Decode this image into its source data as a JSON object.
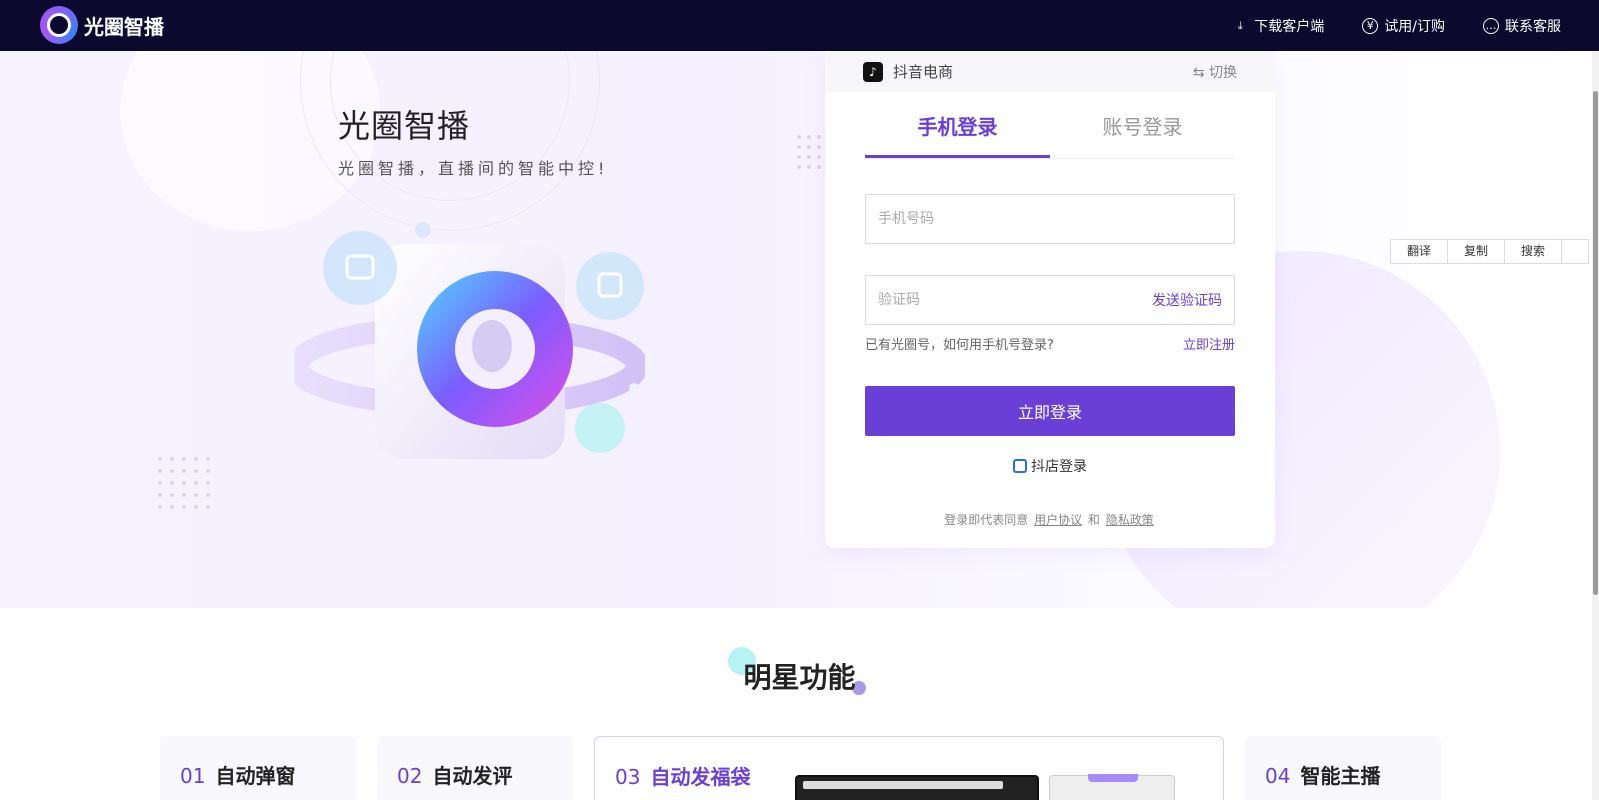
{
  "nav": {
    "logo_text": "光圈智播",
    "links": [
      {
        "label": "下载客户端",
        "icon": "download-icon",
        "glyph": "⤓"
      },
      {
        "label": "试用/订购",
        "icon": "yen-icon",
        "glyph": "¥"
      },
      {
        "label": "联系客服",
        "icon": "chat-icon",
        "glyph": "…"
      }
    ]
  },
  "hero": {
    "title": "光圈智播",
    "subtitle": "光圈智播，直播间的智能中控!"
  },
  "login": {
    "platform": "抖音电商",
    "switch_label": "⇆ 切换",
    "tabs": [
      "手机登录",
      "账号登录"
    ],
    "phone_placeholder": "手机号码",
    "code_placeholder": "验证码",
    "send_code": "发送验证码",
    "hint": "已有光圈号，如何用手机号登录?",
    "register": "立即注册",
    "submit": "立即登录",
    "shop_login": "抖店登录",
    "agree_prefix": "登录即代表同意",
    "agree_terms": "用户协议",
    "agree_and": "和",
    "agree_privacy": "隐私政策"
  },
  "sidetool": [
    "翻译",
    "复制",
    "搜索",
    ""
  ],
  "features": {
    "title": "明星功能",
    "items": [
      {
        "num": "01",
        "label": "自动弹窗"
      },
      {
        "num": "02",
        "label": "自动发评"
      },
      {
        "num": "03",
        "label": "自动发福袋"
      },
      {
        "num": "04",
        "label": "智能主播"
      }
    ]
  },
  "colors": {
    "brand": "#6a3fd8",
    "nav_bg": "#0b0a2e"
  }
}
